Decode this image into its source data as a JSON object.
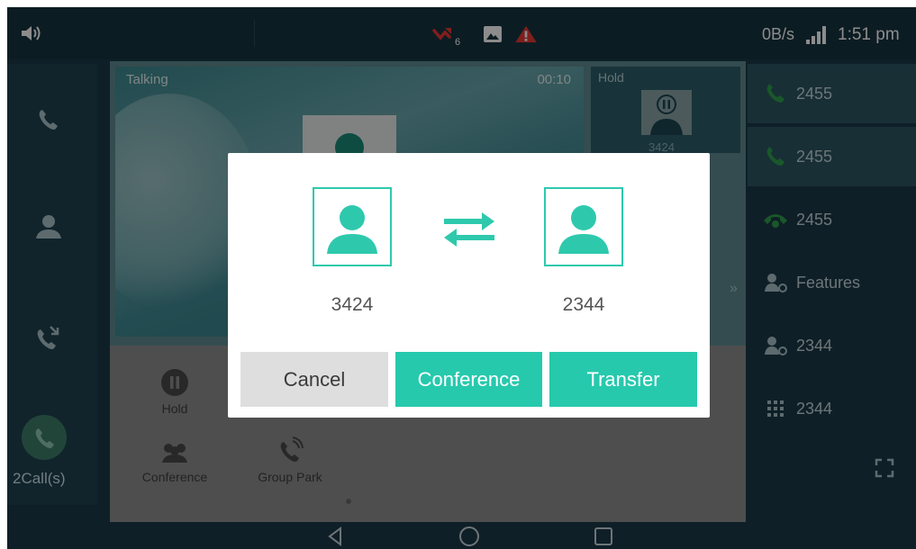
{
  "status_bar": {
    "notification_count": "6",
    "network_speed": "0B/s",
    "time": "1:51 pm",
    "icons": [
      "volume-icon",
      "missed-call-icon",
      "image-icon",
      "alert-icon",
      "signal-icon"
    ]
  },
  "left_rail": {
    "items": [
      "phone-icon",
      "contacts-icon",
      "call-log-icon"
    ],
    "calls_label": "2Call(s)"
  },
  "call_area": {
    "talking_label": "Talking",
    "talking_duration": "00:10",
    "hold_label": "Hold",
    "hold_number": "3424"
  },
  "actions": {
    "hold": "Hold",
    "conference": "Conference",
    "group_park": "Group Park"
  },
  "line_keys": [
    {
      "label": "2455",
      "icon": "phone-green-icon"
    },
    {
      "label": "2455",
      "icon": "phone-green-icon"
    },
    {
      "label": "2455",
      "icon": "phone-ringing-icon"
    },
    {
      "label": "Features",
      "icon": "user-settings-icon"
    },
    {
      "label": "2344",
      "icon": "user-settings-icon"
    },
    {
      "label": "2344",
      "icon": "dialpad-icon"
    }
  ],
  "dialog": {
    "from_number": "3424",
    "to_number": "2344",
    "cancel_label": "Cancel",
    "conference_label": "Conference",
    "transfer_label": "Transfer"
  },
  "colors": {
    "accent": "#27c9ad",
    "background": "#1c3a48",
    "alert": "#e53935"
  }
}
